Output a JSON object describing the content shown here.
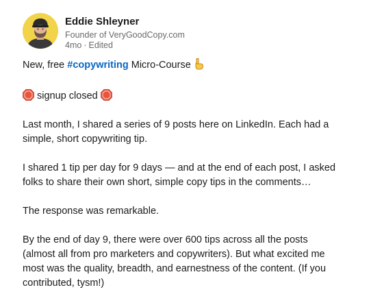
{
  "post": {
    "author": {
      "name": "Eddie Shleyner",
      "headline": "Founder of VeryGoodCopy.com",
      "time": "4mo",
      "edited": "Edited",
      "avatar_bg": "#f2d44a"
    },
    "intro": {
      "prefix": "New, free ",
      "hashtag": "#copywriting",
      "suffix": " Micro-Course ",
      "emoji": "pointing-down-hand-icon"
    },
    "signup": {
      "text": " signup closed ",
      "emoji": "stop-sign-icon"
    },
    "paragraphs": [
      {
        "lines": [
          "Last month, I shared a series of 9 posts here on LinkedIn. Each had a",
          "simple, short copywriting tip."
        ]
      },
      {
        "lines": [
          "I shared 1 tip per day for 9 days — and at the end of each post, I asked",
          "folks to share their own short, simple copy tips in the comments…"
        ]
      },
      {
        "lines": [
          "The response was remarkable."
        ]
      },
      {
        "lines": [
          "By the end of day 9, there were over 600 tips across all the posts",
          "(almost all from pro marketers and copywriters). But what excited me",
          "most was the quality, breadth, and earnestness of the content. (If you",
          "contributed, tysm!)"
        ]
      }
    ]
  },
  "colors": {
    "hashtag": "#0a66c2",
    "stop_sign": "#e8553e"
  }
}
